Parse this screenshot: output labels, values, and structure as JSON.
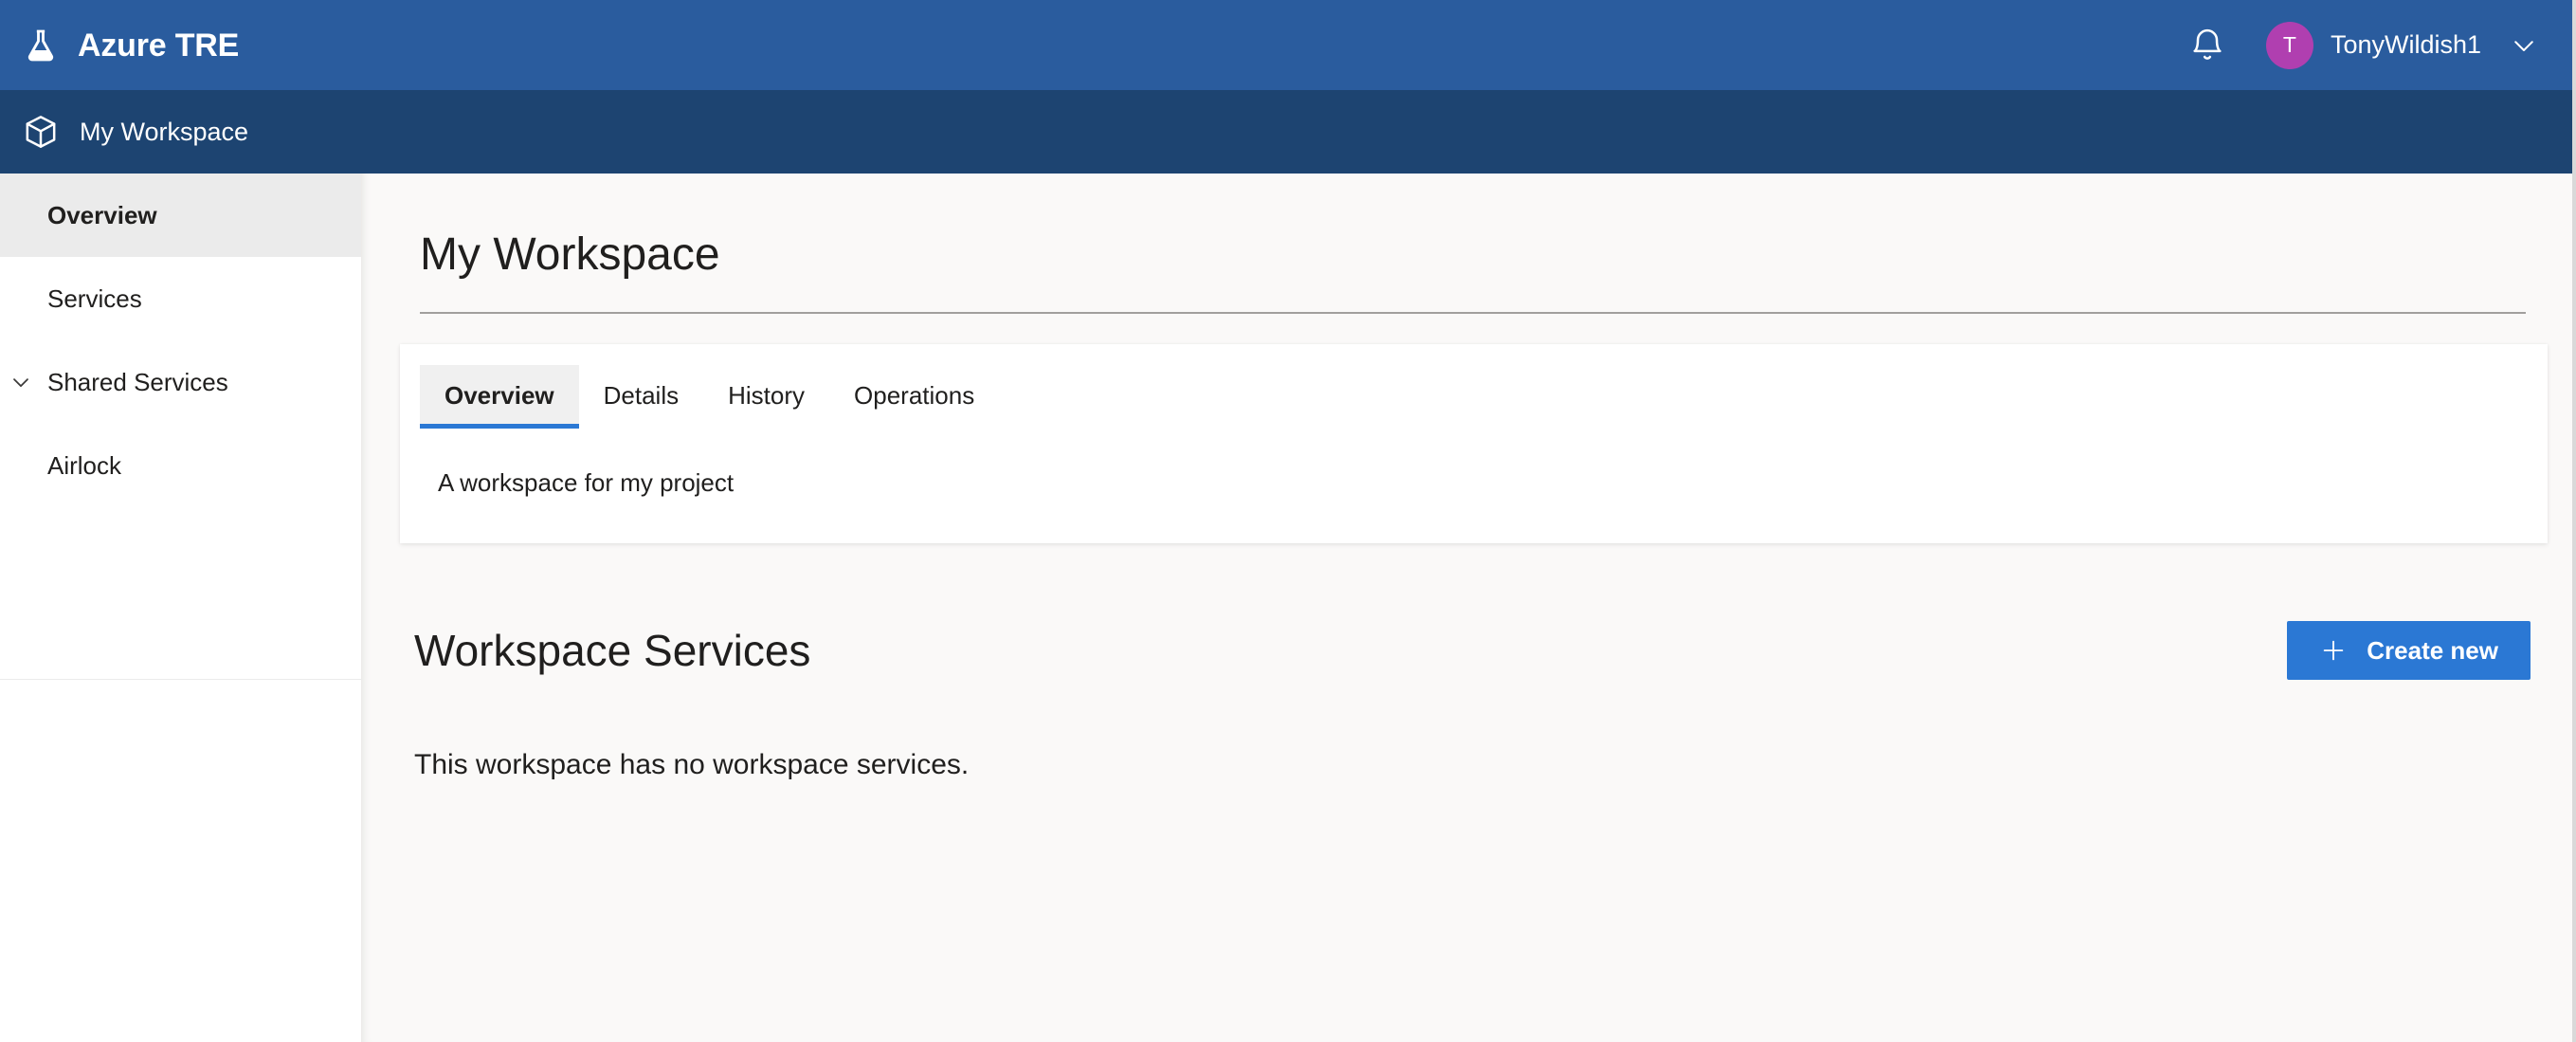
{
  "header": {
    "brand_icon": "flask-icon",
    "brand_title": "Azure TRE",
    "notification_icon": "bell-icon",
    "avatar_initial": "T",
    "avatar_color": "#b03fb0",
    "user_name": "TonyWildish1",
    "user_chevron_icon": "chevron-down-icon"
  },
  "breadcrumb": {
    "icon": "cube-icon",
    "label": "My Workspace"
  },
  "sidebar": {
    "items": [
      {
        "label": "Overview",
        "selected": true,
        "icon": null
      },
      {
        "label": "Services",
        "selected": false,
        "icon": null
      },
      {
        "label": "Shared Services",
        "selected": false,
        "icon": "chevron-down-icon"
      },
      {
        "label": "Airlock",
        "selected": false,
        "icon": null
      }
    ]
  },
  "main": {
    "page_title": "My Workspace",
    "tabs": [
      {
        "label": "Overview",
        "active": true
      },
      {
        "label": "Details",
        "active": false
      },
      {
        "label": "History",
        "active": false
      },
      {
        "label": "Operations",
        "active": false
      }
    ],
    "tab_body_text": "A workspace for my project",
    "section_title": "Workspace Services",
    "create_button_label": "Create new",
    "create_button_icon": "plus-icon",
    "create_button_color": "#2b78d4",
    "empty_message": "This workspace has no workspace services."
  },
  "theme": {
    "topbar_color": "#2a5c9e",
    "subbar_color": "#1d4471",
    "accent_color": "#2b78d4",
    "content_bg": "#faf9f8"
  }
}
